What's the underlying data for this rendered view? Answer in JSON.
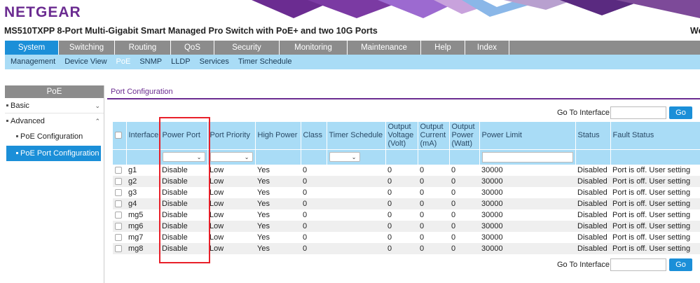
{
  "brand": {
    "logo_text": "NETGEAR",
    "logo_mark": "R"
  },
  "header": {
    "device_title": "MS510TXPP 8-Port Multi-Gigabit Smart Managed Pro Switch with PoE+ and two 10G Ports",
    "welcome_text": "We"
  },
  "main_nav": [
    {
      "label": "System",
      "active": true
    },
    {
      "label": "Switching"
    },
    {
      "label": "Routing"
    },
    {
      "label": "QoS"
    },
    {
      "label": "Security"
    },
    {
      "label": "Monitoring"
    },
    {
      "label": "Maintenance"
    },
    {
      "label": "Help"
    },
    {
      "label": "Index"
    }
  ],
  "sub_nav": [
    {
      "label": "Management"
    },
    {
      "label": "Device View"
    },
    {
      "label": "PoE",
      "active": true
    },
    {
      "label": "SNMP"
    },
    {
      "label": "LLDP"
    },
    {
      "label": "Services"
    },
    {
      "label": "Timer Schedule"
    }
  ],
  "sidebar": {
    "title": "PoE",
    "basic_label": "Basic",
    "advanced_label": "Advanced",
    "items": [
      {
        "label": "PoE Configuration"
      },
      {
        "label": "PoE Port Configuration",
        "active": true
      }
    ]
  },
  "content": {
    "tab_label": "Port Configuration",
    "goto_label": "Go To Interface",
    "go_button": "Go"
  },
  "table": {
    "columns": [
      "",
      "Interface",
      "Power Port",
      "Port Priority",
      "High Power",
      "Class",
      "Timer Schedule",
      "Output Voltage (Volt)",
      "Output Current (mA)",
      "Output Power (Watt)",
      "Power Limit",
      "Status",
      "Fault Status"
    ],
    "rows": [
      [
        "g1",
        "Disable",
        "Low",
        "Yes",
        "0",
        "",
        "0",
        "0",
        "0",
        "30000",
        "Disabled",
        "Port is off. User setting"
      ],
      [
        "g2",
        "Disable",
        "Low",
        "Yes",
        "0",
        "",
        "0",
        "0",
        "0",
        "30000",
        "Disabled",
        "Port is off. User setting"
      ],
      [
        "g3",
        "Disable",
        "Low",
        "Yes",
        "0",
        "",
        "0",
        "0",
        "0",
        "30000",
        "Disabled",
        "Port is off. User setting"
      ],
      [
        "g4",
        "Disable",
        "Low",
        "Yes",
        "0",
        "",
        "0",
        "0",
        "0",
        "30000",
        "Disabled",
        "Port is off. User setting"
      ],
      [
        "mg5",
        "Disable",
        "Low",
        "Yes",
        "0",
        "",
        "0",
        "0",
        "0",
        "30000",
        "Disabled",
        "Port is off. User setting"
      ],
      [
        "mg6",
        "Disable",
        "Low",
        "Yes",
        "0",
        "",
        "0",
        "0",
        "0",
        "30000",
        "Disabled",
        "Port is off. User setting"
      ],
      [
        "mg7",
        "Disable",
        "Low",
        "Yes",
        "0",
        "",
        "0",
        "0",
        "0",
        "30000",
        "Disabled",
        "Port is off. User setting"
      ],
      [
        "mg8",
        "Disable",
        "Low",
        "Yes",
        "0",
        "",
        "0",
        "0",
        "0",
        "30000",
        "Disabled",
        "Port is off. User setting"
      ]
    ]
  },
  "colors": {
    "brand_purple": "#6b2c91",
    "active_blue": "#1b8fd8",
    "subnav_light_blue": "#a9dcf6",
    "nav_gray": "#8c8c8c",
    "highlight_red": "#e8202a"
  }
}
